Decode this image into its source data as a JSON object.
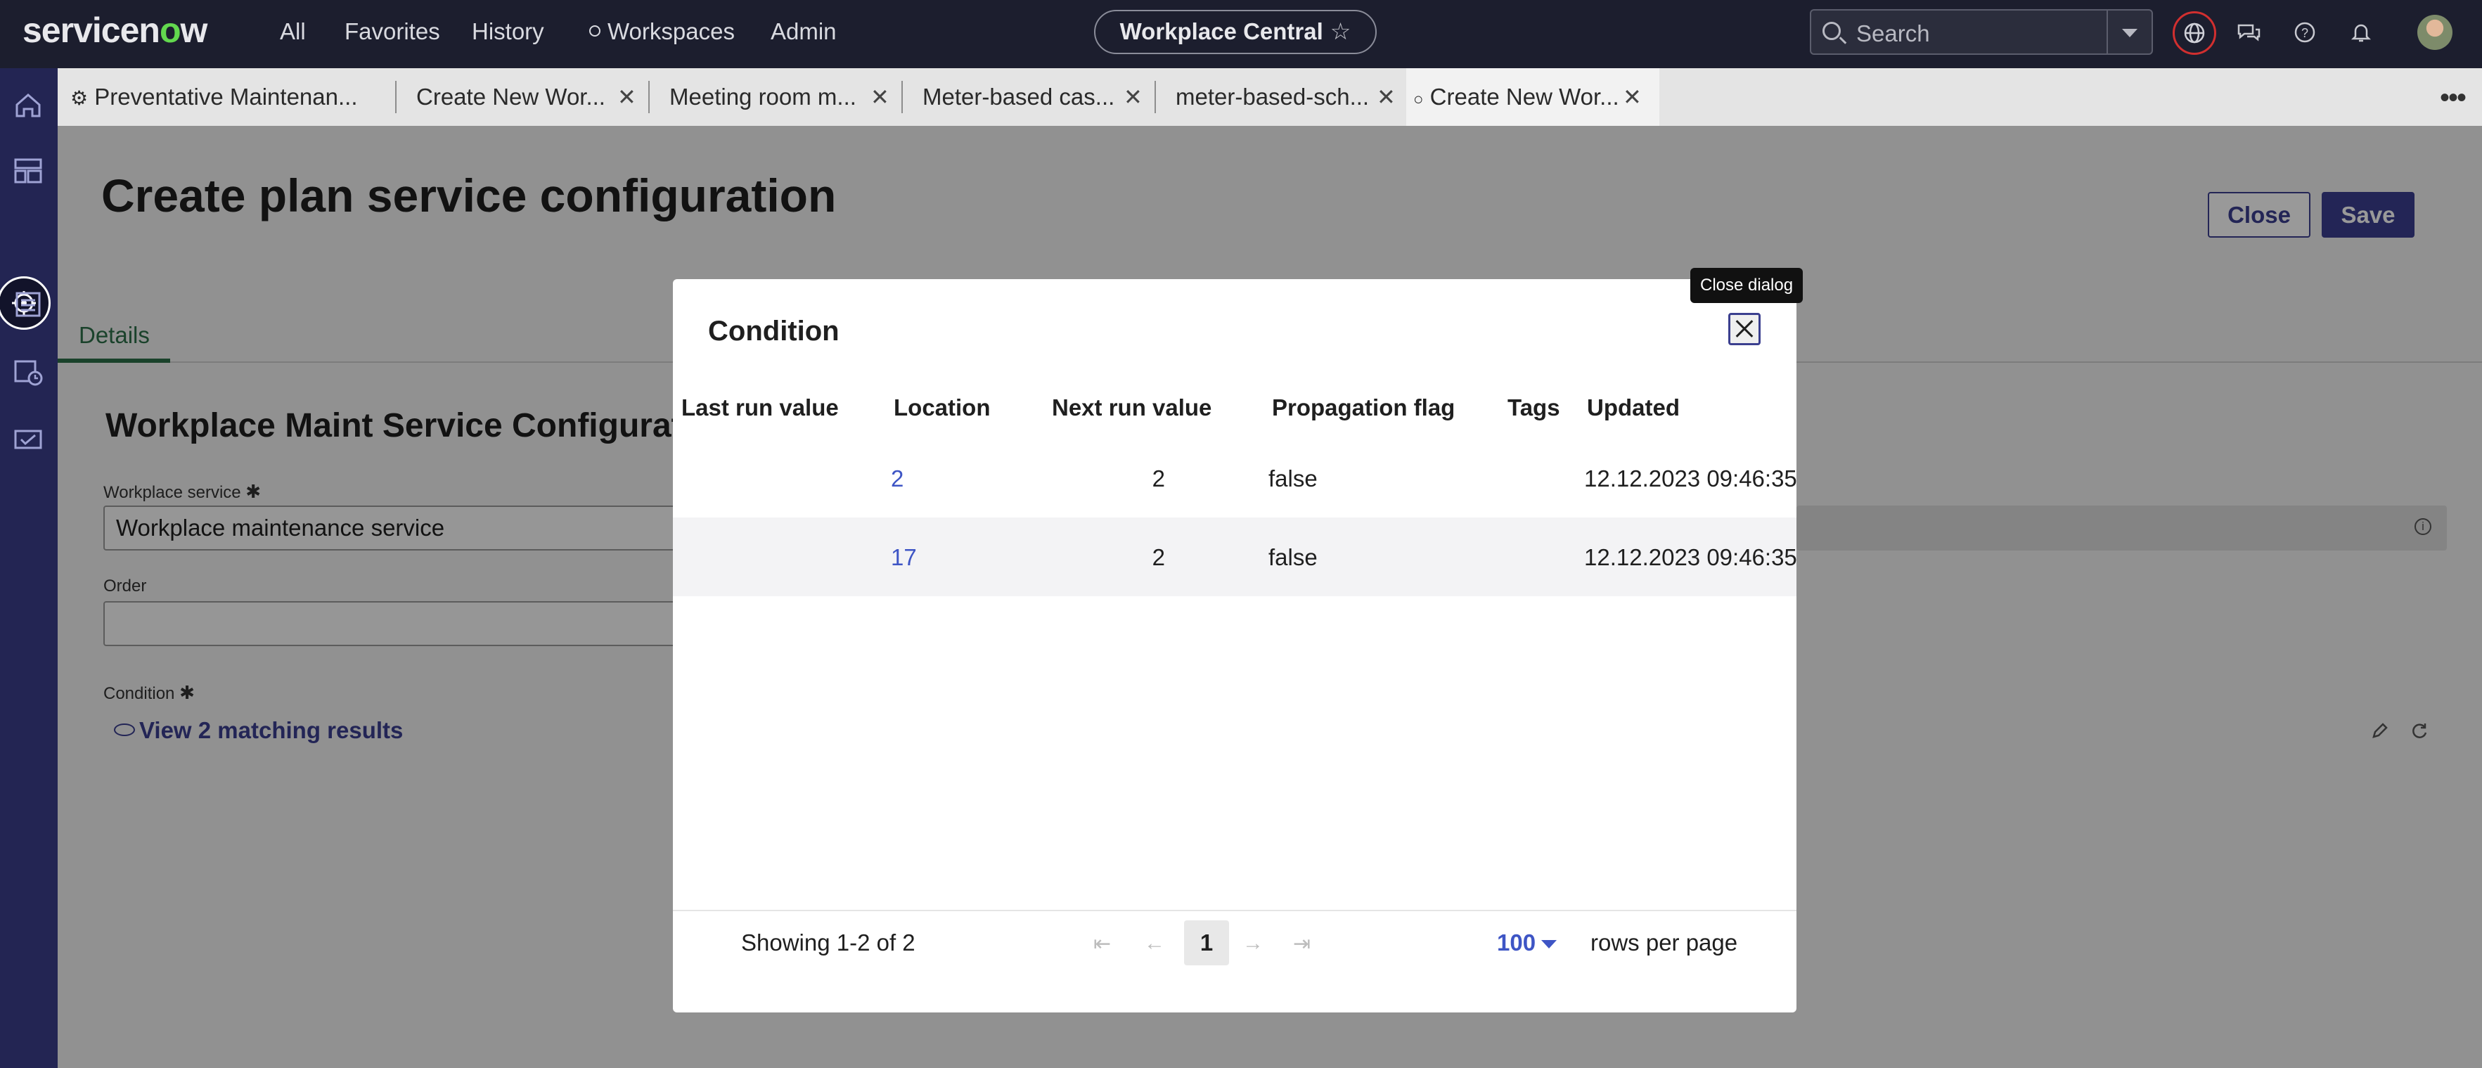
{
  "app": {
    "logo_text": "servicenow",
    "nav": [
      "All",
      "Favorites",
      "History",
      "Workspaces",
      "Admin"
    ],
    "workspace_pill": "Workplace Central",
    "search_placeholder": "Search"
  },
  "tabs": [
    {
      "label": "Preventative Maintenan...",
      "closable": false
    },
    {
      "label": "Create New Wor...",
      "closable": true
    },
    {
      "label": "Meeting room m...",
      "closable": true
    },
    {
      "label": "Meter-based cas...",
      "closable": true
    },
    {
      "label": "meter-based-sch...",
      "closable": true
    },
    {
      "label": "Create New Wor...",
      "closable": true,
      "active": true
    }
  ],
  "page": {
    "title": "Create plan service configuration",
    "close_label": "Close",
    "save_label": "Save",
    "details_tab": "Details",
    "section_title": "Workplace Maint Service Configuration",
    "fields": {
      "workplace_service_label": "Workplace service",
      "workplace_service_value": "Workplace maintenance service",
      "order_label": "Order",
      "order_value": "",
      "condition_label": "Condition",
      "view_results": "View 2 matching results"
    }
  },
  "modal": {
    "title": "Condition",
    "tooltip": "Close dialog",
    "columns": [
      "Last run value",
      "Location",
      "Next run value",
      "Propagation flag",
      "Tags",
      "Updated"
    ],
    "rows": [
      {
        "last_run_value": "",
        "location": "2",
        "next_run_value": "2",
        "propagation_flag": "false",
        "tags": "",
        "updated": "12.12.2023 09:46:35"
      },
      {
        "last_run_value": "",
        "location": "17",
        "next_run_value": "2",
        "propagation_flag": "false",
        "tags": "",
        "updated": "12.12.2023 09:46:35"
      }
    ],
    "footer": {
      "showing": "Showing 1-2 of 2",
      "current_page": "1",
      "rows_per_page_value": "100",
      "rows_per_page_label": "rows per page"
    }
  },
  "colors": {
    "nav_bg": "#1c1e2e",
    "rail_bg": "#232553",
    "primary": "#3b3f8f",
    "link": "#3e55c5",
    "accent_green": "#62d84e",
    "details_green": "#2c6e49"
  }
}
